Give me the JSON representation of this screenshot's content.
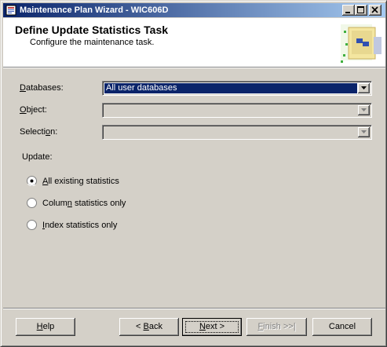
{
  "window": {
    "title": "Maintenance Plan Wizard - WIC606D",
    "minimize_label": "minimize",
    "maximize_label": "maximize",
    "close_label": "close"
  },
  "header": {
    "title": "Define Update Statistics Task",
    "subtitle": "Configure the maintenance task."
  },
  "form": {
    "databases": {
      "label_pre": "",
      "label_key": "D",
      "label_post": "atabases:",
      "value": "All user databases"
    },
    "object": {
      "label_pre": "",
      "label_key": "O",
      "label_post": "bject:",
      "value": ""
    },
    "selection": {
      "label_pre": "Selecti",
      "label_key": "o",
      "label_post": "n:",
      "value": ""
    }
  },
  "update": {
    "label": "Update:",
    "options": [
      {
        "pre": "",
        "key": "A",
        "post": "ll existing statistics",
        "selected": true
      },
      {
        "pre": "Colum",
        "key": "n",
        "post": " statistics only",
        "selected": false
      },
      {
        "pre": "",
        "key": "I",
        "post": "ndex statistics only",
        "selected": false
      }
    ]
  },
  "buttons": {
    "help": {
      "pre": "",
      "key": "H",
      "post": "elp"
    },
    "back": {
      "pre": "< ",
      "key": "B",
      "post": "ack"
    },
    "next": {
      "pre": "",
      "key": "N",
      "post": "ext >"
    },
    "finish": {
      "pre": "",
      "key": "F",
      "post": "inish >>|"
    },
    "cancel": {
      "pre": "Cancel",
      "key": "",
      "post": ""
    }
  }
}
